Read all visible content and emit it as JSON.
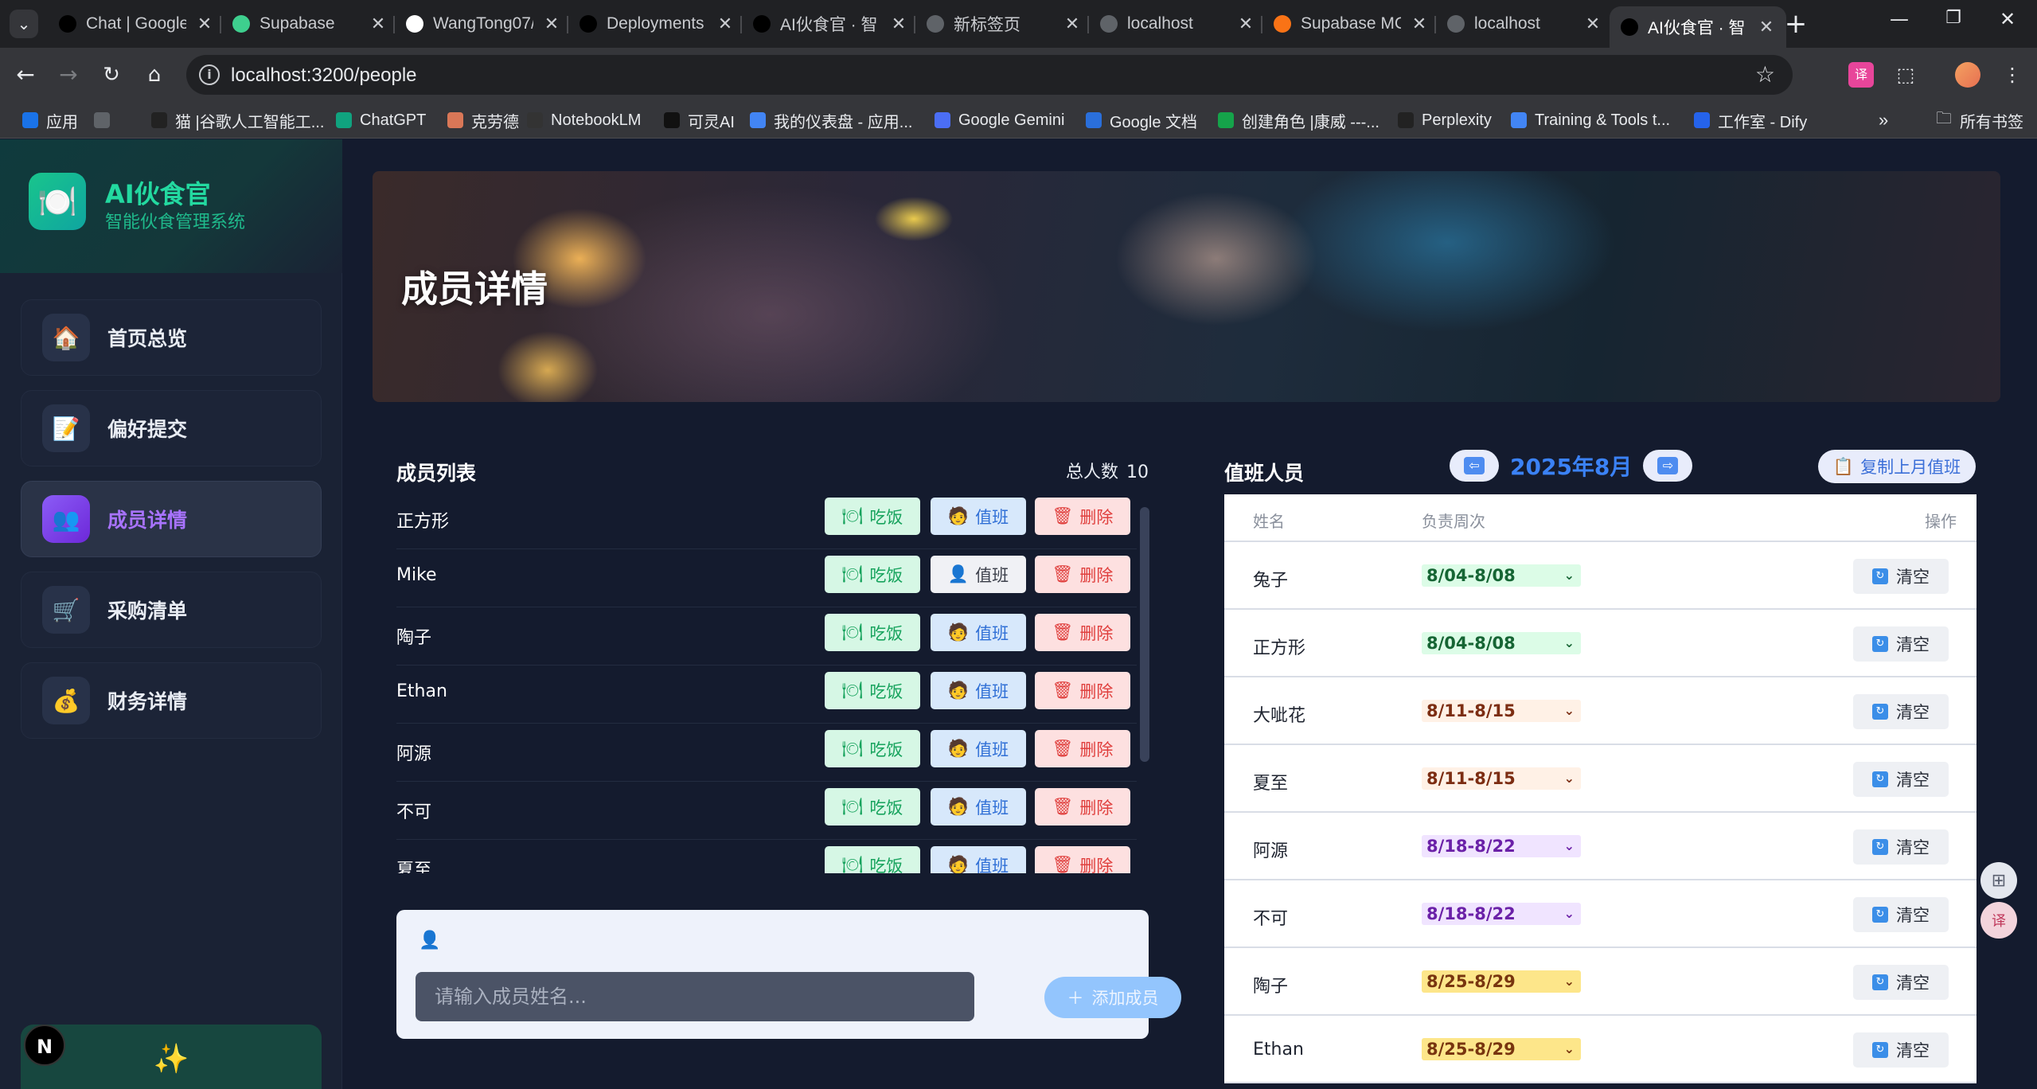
{
  "browser": {
    "tabs": [
      {
        "title": "Chat | Google",
        "icon": "chat-icon",
        "color": "#000000"
      },
      {
        "title": "Supabase",
        "icon": "supabase-icon",
        "color": "#3ecf8e"
      },
      {
        "title": "WangTong07/",
        "icon": "github-icon",
        "color": "#ffffff"
      },
      {
        "title": "Deployments",
        "icon": "vercel-icon",
        "color": "#000000"
      },
      {
        "title": "AI伙食官 · 智",
        "icon": "vercel-icon",
        "color": "#000000"
      },
      {
        "title": "新标签页",
        "icon": "chrome-icon",
        "color": "#5f6368"
      },
      {
        "title": "localhost",
        "icon": "globe-icon",
        "color": "#5f6368"
      },
      {
        "title": "Supabase MC",
        "icon": "supabase-mcp-icon",
        "color": "#f97316"
      },
      {
        "title": "localhost",
        "icon": "globe-icon",
        "color": "#5f6368"
      },
      {
        "title": "AI伙食官 · 智",
        "icon": "vercel-icon",
        "color": "#000000"
      }
    ],
    "url": "localhost:3200/people",
    "bookmarks": [
      {
        "label": "应用",
        "icon": "apps-icon"
      },
      {
        "label": "",
        "icon": "grid-icon"
      },
      {
        "label": "猫 |谷歌人工智能工...",
        "icon": "cat-icon"
      },
      {
        "label": "ChatGPT",
        "icon": "openai-icon"
      },
      {
        "label": "克劳德",
        "icon": "claude-icon"
      },
      {
        "label": "NotebookLM",
        "icon": "notebooklm-icon"
      },
      {
        "label": "可灵AI",
        "icon": "kling-icon"
      },
      {
        "label": "我的仪表盘 - 应用...",
        "icon": "google-icon"
      },
      {
        "label": "Google Gemini",
        "icon": "gemini-icon"
      },
      {
        "label": "Google 文档",
        "icon": "docs-icon"
      },
      {
        "label": "创建角色 |康威 ---...",
        "icon": "conway-icon"
      },
      {
        "label": "Perplexity",
        "icon": "perplexity-icon"
      },
      {
        "label": "Training & Tools t...",
        "icon": "google-icon"
      },
      {
        "label": "工作室 - Dify",
        "icon": "dify-icon"
      }
    ],
    "bookmarks_more": "»",
    "all_bookmarks": "所有书签"
  },
  "sidebar": {
    "brand_title": "AI伙食官",
    "brand_subtitle": "智能伙食管理系统",
    "items": [
      {
        "label": "首页总览",
        "icon": "house-icon",
        "emoji": "🏠",
        "active": false
      },
      {
        "label": "偏好提交",
        "icon": "memo-icon",
        "emoji": "📝",
        "active": false
      },
      {
        "label": "成员详情",
        "icon": "people-icon",
        "emoji": "👥",
        "active": true
      },
      {
        "label": "采购清单",
        "icon": "cart-icon",
        "emoji": "🛒",
        "active": false
      },
      {
        "label": "财务详情",
        "icon": "money-bag-icon",
        "emoji": "💰",
        "active": false
      }
    ],
    "next_badge": "N",
    "bottom_emoji": "✨"
  },
  "page": {
    "hero_title": "成员详情"
  },
  "members": {
    "title": "成员列表",
    "total_label": "总人数",
    "total": "10",
    "eat_label": "吃饭",
    "duty_label": "值班",
    "delete_label": "删除",
    "rows": [
      {
        "name": "正方形",
        "duty_on": true
      },
      {
        "name": "Mike",
        "duty_on": false
      },
      {
        "name": "陶子",
        "duty_on": true
      },
      {
        "name": "Ethan",
        "duty_on": true
      },
      {
        "name": "阿源",
        "duty_on": true
      },
      {
        "name": "不可",
        "duty_on": true
      },
      {
        "name": "夏至",
        "duty_on": true
      }
    ],
    "add_placeholder": "请输入成员姓名...",
    "add_button": "添加成员"
  },
  "duty": {
    "title": "值班人员",
    "month": "2025年8月",
    "copy_button": "复制上月值班",
    "headers": {
      "name": "姓名",
      "week": "负责周次",
      "action": "操作"
    },
    "clear_label": "清空",
    "rows": [
      {
        "name": "兔子",
        "week": "8/04-8/08",
        "bg": "#dcfce7",
        "fg": "#166534"
      },
      {
        "name": "正方形",
        "week": "8/04-8/08",
        "bg": "#dcfce7",
        "fg": "#166534"
      },
      {
        "name": "大呲花",
        "week": "8/11-8/15",
        "bg": "#fff1e6",
        "fg": "#7c2d12"
      },
      {
        "name": "夏至",
        "week": "8/11-8/15",
        "bg": "#fff1e6",
        "fg": "#7c2d12"
      },
      {
        "name": "阿源",
        "week": "8/18-8/22",
        "bg": "#f0e4ff",
        "fg": "#6b21a8"
      },
      {
        "name": "不可",
        "week": "8/18-8/22",
        "bg": "#f0e4ff",
        "fg": "#6b21a8"
      },
      {
        "name": "陶子",
        "week": "8/25-8/29",
        "bg": "#fde68a",
        "fg": "#78350f"
      },
      {
        "name": "Ethan",
        "week": "8/25-8/29",
        "bg": "#fde68a",
        "fg": "#78350f"
      }
    ]
  }
}
